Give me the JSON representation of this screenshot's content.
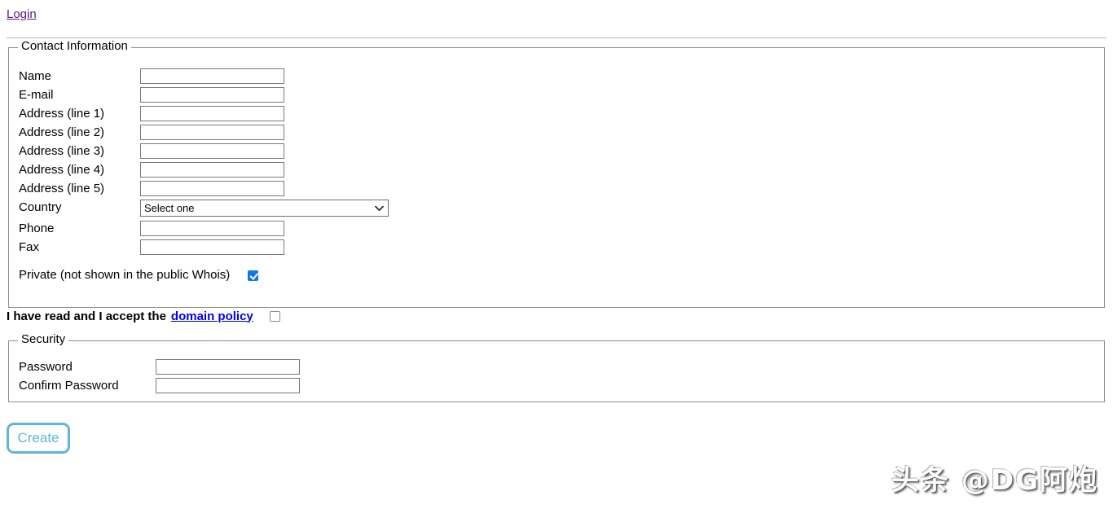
{
  "page": {
    "login_link": "Login"
  },
  "contact": {
    "legend": "Contact Information",
    "rows": [
      {
        "label": "Name",
        "value": "",
        "placeholder": "",
        "type": "text"
      },
      {
        "label": "E-mail",
        "value": "",
        "placeholder": "",
        "type": "text"
      },
      {
        "label": "Address (line 1)",
        "value": "",
        "placeholder": "",
        "type": "text"
      },
      {
        "label": "Address (line 2)",
        "value": "",
        "placeholder": "",
        "type": "text"
      },
      {
        "label": "Address (line 3)",
        "value": "",
        "placeholder": "",
        "type": "text"
      },
      {
        "label": "Address (line 4)",
        "value": "",
        "placeholder": "",
        "type": "text"
      },
      {
        "label": "Address (line 5)",
        "value": "",
        "placeholder": "",
        "type": "text"
      },
      {
        "label": "Country",
        "value": "Select one",
        "placeholder": "",
        "type": "select"
      },
      {
        "label": "Phone",
        "value": "",
        "placeholder": "",
        "type": "text"
      },
      {
        "label": "Fax",
        "value": "",
        "placeholder": "",
        "type": "text"
      }
    ],
    "country_selected": "Select one",
    "private": {
      "label": "Private (not shown in the public Whois)",
      "checked": true
    }
  },
  "policy": {
    "text": "I have read and I accept the",
    "link_label": "domain policy",
    "checked": false
  },
  "security": {
    "legend": "Security",
    "rows": [
      {
        "label": "Password",
        "value": "",
        "placeholder": ""
      },
      {
        "label": "Confirm Password",
        "value": "",
        "placeholder": ""
      }
    ]
  },
  "actions": {
    "create_label": "Create"
  },
  "watermark": {
    "text": "头条 @DG阿炮"
  },
  "colors": {
    "visited_link": "#551a8b",
    "link": "#0000ee",
    "checkbox_checked": "#0b76ef",
    "button_accent": "#63b3dc",
    "border": "#8f8f8f"
  }
}
